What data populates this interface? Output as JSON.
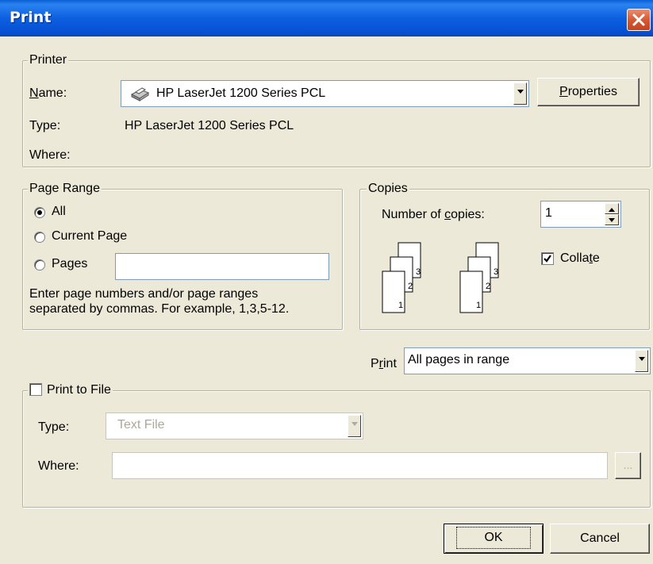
{
  "window": {
    "title": "Print"
  },
  "printer": {
    "group_label": "Printer",
    "name_label": "Name:",
    "name_value": "HP LaserJet 1200 Series PCL",
    "properties_label": "Properties",
    "type_label": "Type:",
    "type_value": "HP LaserJet 1200 Series PCL",
    "where_label": "Where:",
    "where_value": ""
  },
  "page_range": {
    "group_label": "Page Range",
    "all_label": "All",
    "current_page_label": "Current Page",
    "pages_label": "Pages",
    "pages_value": "",
    "selected": "All",
    "hint_line1": "Enter page numbers and/or page ranges",
    "hint_line2": "separated by commas.  For example, 1,3,5-12."
  },
  "copies": {
    "group_label": "Copies",
    "number_label": "Number of copies:",
    "number_value": "1",
    "collate_label": "Collate",
    "collate_checked": true,
    "collate_icon_pages": [
      "1",
      "2",
      "3"
    ]
  },
  "print_what": {
    "label": "Print",
    "value": "All pages in range"
  },
  "print_to_file": {
    "label": "Print to File",
    "checked": false,
    "type_label": "Type:",
    "type_value": "Text File",
    "where_label": "Where:",
    "where_value": "",
    "browse_label": "..."
  },
  "actions": {
    "ok_label": "OK",
    "cancel_label": "Cancel"
  },
  "colors": {
    "titlebar": "#0a5fd6",
    "face": "#ece9d8",
    "close": "#d65a35"
  }
}
